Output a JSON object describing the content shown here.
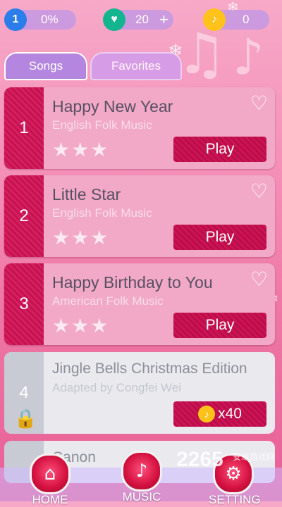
{
  "top_bar": {
    "level": "1",
    "progress": "0%",
    "lives": "20",
    "lives_add": "+",
    "coins": "0"
  },
  "tabs": [
    {
      "label": "Songs",
      "active": true
    },
    {
      "label": "Favorites",
      "active": false
    }
  ],
  "songs": [
    {
      "number": "1",
      "title": "Happy New Year",
      "artist": "English Folk Music",
      "stars": "★★★",
      "button": "Play",
      "locked": false
    },
    {
      "number": "2",
      "title": "Little Star",
      "artist": "English Folk Music",
      "stars": "★★★",
      "button": "Play",
      "locked": false
    },
    {
      "number": "3",
      "title": "Happy Birthday to You",
      "artist": "American Folk Music",
      "stars": "★★★",
      "button": "Play",
      "locked": false
    },
    {
      "number": "4",
      "title": "Jingle Bells Christmas Edition",
      "artist": "Adapted by Congfei Wei",
      "button": "x40",
      "locked": true
    },
    {
      "number": "",
      "title": "Canon",
      "locked": true
    }
  ],
  "nav": {
    "home": "HOME",
    "music": "MUSIC",
    "setting": "SETTING"
  },
  "watermark": {
    "main": "2265",
    "sub": "安卓游戏网"
  },
  "colors": {
    "accent": "#cc1454",
    "card": "#f2a9c8",
    "locked_card": "#e9e9ee",
    "coin": "#ffc21a"
  }
}
